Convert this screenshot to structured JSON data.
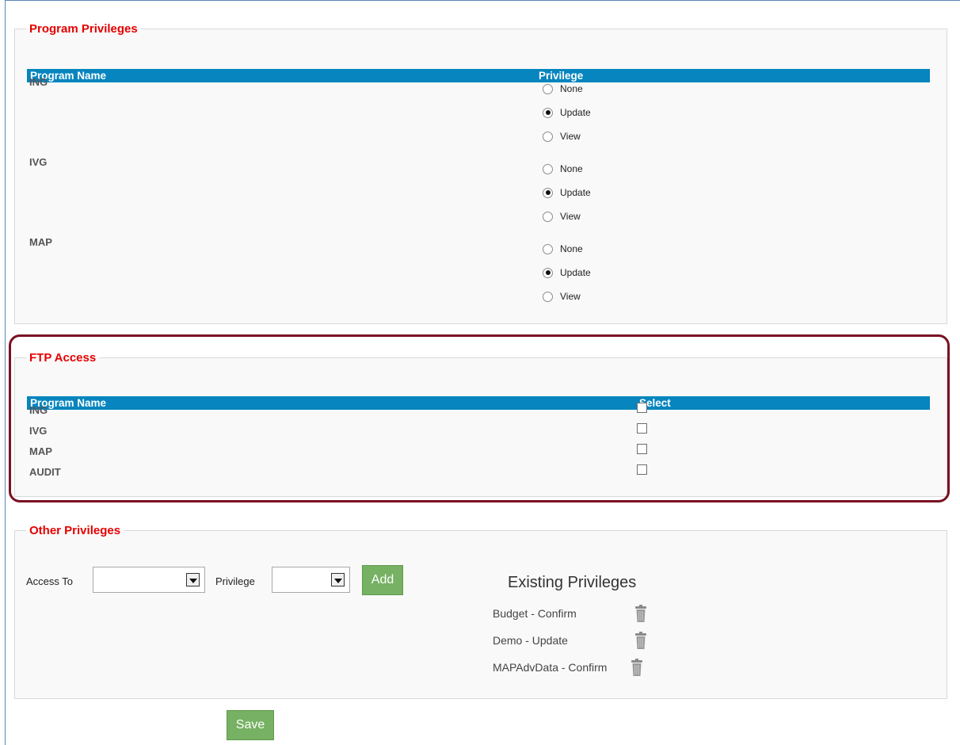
{
  "program_privileges": {
    "legend": "Program Privileges",
    "col_program": "Program Name",
    "col_privilege": "Privilege",
    "rows": [
      {
        "name": "ING",
        "options": [
          "None",
          "Update",
          "View"
        ],
        "selected": "Update"
      },
      {
        "name": "IVG",
        "options": [
          "None",
          "Update",
          "View"
        ],
        "selected": "Update"
      },
      {
        "name": "MAP",
        "options": [
          "None",
          "Update",
          "View"
        ],
        "selected": "Update"
      }
    ]
  },
  "ftp_access": {
    "legend": "FTP Access",
    "col_program": "Program Name",
    "col_select": "Select",
    "rows": [
      {
        "name": "ING",
        "checked": false
      },
      {
        "name": "IVG",
        "checked": false
      },
      {
        "name": "MAP",
        "checked": false
      },
      {
        "name": "AUDIT",
        "checked": false
      }
    ]
  },
  "other_privileges": {
    "legend": "Other Privileges",
    "access_to_label": "Access To",
    "access_to_value": "",
    "privilege_label": "Privilege",
    "privilege_value": "",
    "add_label": "Add",
    "existing_title": "Existing Privileges",
    "existing": [
      {
        "label": "Budget - Confirm",
        "icon": "trash-icon"
      },
      {
        "label": "Demo - Update",
        "icon": "trash-icon"
      },
      {
        "label": "MAPAdvData - Confirm",
        "icon": "trash-icon"
      }
    ]
  },
  "save_label": "Save",
  "colors": {
    "header_bar": "#0685be",
    "legend_text": "#e60000",
    "button_green": "#77b163",
    "highlight_border": "#7a1022"
  }
}
